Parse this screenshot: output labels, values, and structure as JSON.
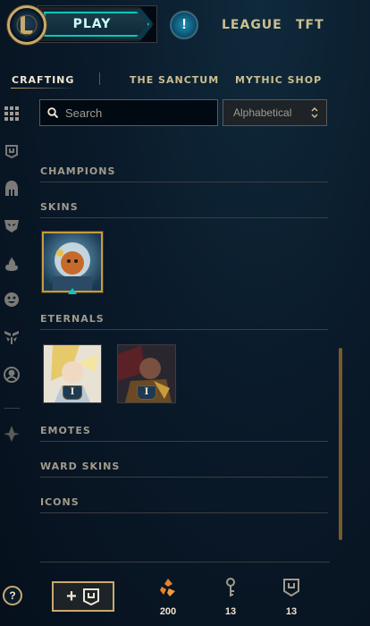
{
  "topbar": {
    "play_label": "PLAY",
    "alert_label": "!",
    "links": [
      "LEAGUE",
      "TFT"
    ]
  },
  "subnav": {
    "tabs": [
      "CRAFTING",
      "THE SANCTUM",
      "MYTHIC SHOP"
    ],
    "active": "CRAFTING"
  },
  "rail": {
    "icons": [
      "grid-icon",
      "chest-icon",
      "helmet-icon",
      "mask-icon",
      "flame-icon",
      "emote-icon",
      "ward-icon",
      "profile-icon",
      "shard-icon"
    ]
  },
  "search": {
    "placeholder": "Search",
    "sort_value": "Alphabetical"
  },
  "sections": {
    "champions": "CHAMPIONS",
    "skins": "SKINS",
    "eternals": "ETERNALS",
    "emotes": "EMOTES",
    "ward_skins": "WARD SKINS",
    "icons": "ICONS"
  },
  "eternals": [
    {
      "badge": "I"
    },
    {
      "badge": "I"
    }
  ],
  "footer": {
    "help_label": "?",
    "add_label": "+",
    "currencies": [
      {
        "icon": "orange-essence-icon",
        "value": "200"
      },
      {
        "icon": "key-icon",
        "value": "13"
      },
      {
        "icon": "chest-icon",
        "value": "13"
      }
    ]
  },
  "colors": {
    "gold": "#c8aa6e",
    "teal": "#0ac8b9",
    "orange_essence": "#e8812a"
  }
}
